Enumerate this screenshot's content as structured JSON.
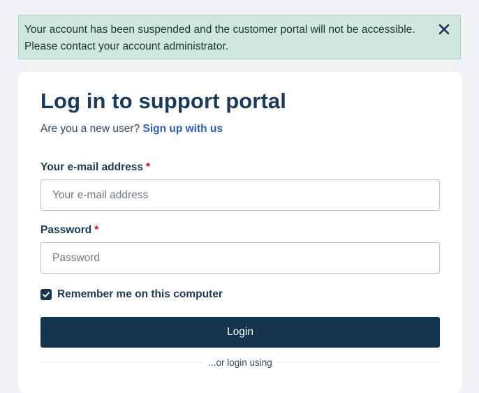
{
  "alert": {
    "message": "Your account has been suspended and the customer portal will not be accessible. Please contact your account administrator.",
    "close_icon": "close-icon"
  },
  "login": {
    "title": "Log in to support portal",
    "new_user_prompt": "Are you a new user?",
    "signup_link": "Sign up with us",
    "email": {
      "label": "Your e-mail address",
      "required_marker": "*",
      "placeholder": "Your e-mail address",
      "value": ""
    },
    "password": {
      "label": "Password",
      "required_marker": "*",
      "placeholder": "Password",
      "value": ""
    },
    "remember_me": {
      "label": "Remember me on this computer",
      "checked": true
    },
    "submit_label": "Login",
    "alt_login_text": "...or login using"
  },
  "colors": {
    "alert_bg": "#cfe7dd",
    "primary": "#15344d",
    "link": "#2e5fb5",
    "required": "#c8102e"
  }
}
